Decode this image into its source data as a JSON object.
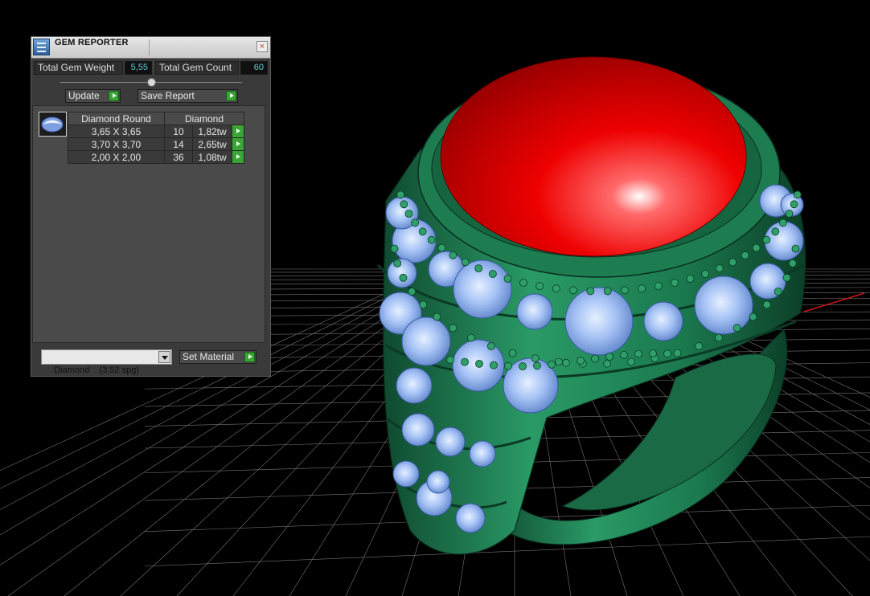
{
  "panel": {
    "title": "GEM REPORTER",
    "close_glyph": "×",
    "total_weight_label": "Total Gem Weight",
    "total_weight_value": "5,55",
    "total_count_label": "Total Gem Count",
    "total_count_value": "60",
    "update_label": "Update",
    "save_report_label": "Save Report",
    "table": {
      "headers": [
        "Diamond Round",
        "Diamond"
      ],
      "rows": [
        {
          "size": "3,65 X 3,65",
          "count": "10",
          "weight": "1,82tw"
        },
        {
          "size": "3,70 X 3,70",
          "count": "14",
          "weight": "2,65tw"
        },
        {
          "size": "2,00 X 2,00",
          "count": "36",
          "weight": "1,08tw"
        }
      ]
    },
    "material_selected": "Diamond    (3,52 spg)",
    "set_material_label": "Set Material"
  },
  "icons": {
    "app": "gem-reporter-icon",
    "close": "close-icon",
    "go": "play-arrow-icon",
    "dropdown": "chevron-down-icon",
    "gem_thumb": "round-diamond-icon"
  },
  "colors": {
    "background": "#000000",
    "grid": "#8a8a8a",
    "metal": "#1f7a4f",
    "gem_blue": "#8fb3f2",
    "center_stone": "#e00000",
    "go_button": "#3aa535",
    "value_text": "#5fd0d8"
  }
}
